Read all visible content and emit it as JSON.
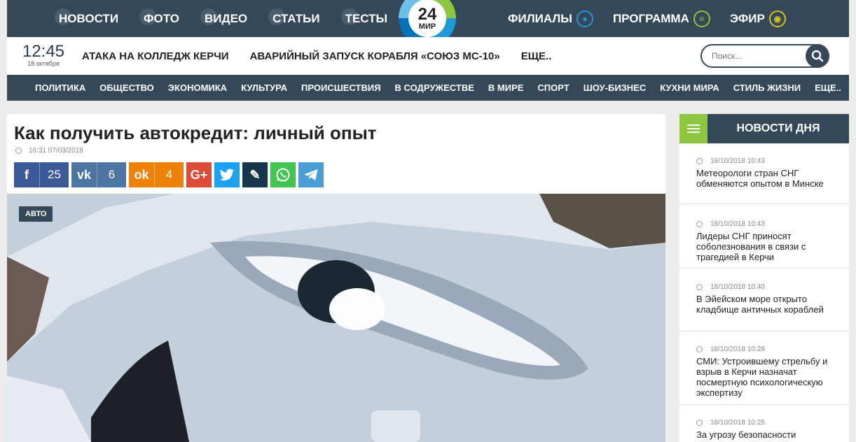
{
  "topnav": {
    "items": [
      "НОВОСТИ",
      "ФОТО",
      "ВИДЕО",
      "СТАТЬИ",
      "ТЕСТЫ"
    ],
    "right": [
      {
        "label": "ФИЛИАЛЫ",
        "icon": "map-pin-icon"
      },
      {
        "label": "ПРОГРАММА",
        "icon": "document-list-icon"
      },
      {
        "label": "ЭФИР",
        "icon": "broadcast-icon"
      }
    ]
  },
  "logo": {
    "number": "24",
    "name": "МИР"
  },
  "clock": {
    "time": "12:45",
    "date": "18 октября"
  },
  "headlines": [
    "АТАКА НА КОЛЛЕДЖ КЕРЧИ",
    "АВАРИЙНЫЙ ЗАПУСК КОРАБЛЯ «СОЮЗ МС-10»",
    "ЕЩЕ.."
  ],
  "search": {
    "placeholder": "Поиск..."
  },
  "categories": [
    "ПОЛИТИКА",
    "ОБЩЕСТВО",
    "ЭКОНОМИКА",
    "КУЛЬТУРА",
    "ПРОИСШЕСТВИЯ",
    "В СОДРУЖЕСТВЕ",
    "В МИРЕ",
    "СПОРТ",
    "ШОУ-БИЗНЕС",
    "КУХНИ МИРА",
    "СТИЛЬ ЖИЗНИ",
    "ЕЩЕ.."
  ],
  "article": {
    "title": "Как получить автокредит: личный опыт",
    "datetime": "16:31 07/03/2018",
    "badge": "АВТО",
    "share": [
      {
        "network": "facebook",
        "glyph": "f",
        "count": "25",
        "color": "#3b5998"
      },
      {
        "network": "vkontakte",
        "glyph": "vk",
        "count": "6",
        "color": "#4c75a3"
      },
      {
        "network": "odnoklassniki",
        "glyph": "ok",
        "count": "4",
        "color": "#ee8208"
      },
      {
        "network": "google-plus",
        "glyph": "G+",
        "count": "",
        "color": "#dd4b39"
      },
      {
        "network": "twitter",
        "glyph": "t",
        "count": "",
        "color": "#1da1f2"
      },
      {
        "network": "livejournal",
        "glyph": "✎",
        "count": "",
        "color": "#15374c"
      },
      {
        "network": "whatsapp",
        "glyph": "w",
        "count": "",
        "color": "#43c553"
      },
      {
        "network": "telegram",
        "glyph": "➤",
        "count": "",
        "color": "#4a9ed6"
      }
    ]
  },
  "sidebar": {
    "title": "НОВОСТИ ДНЯ",
    "news": [
      {
        "time": "18/10/2018 10:43",
        "text": "Метеорологи стран СНГ обменяются опытом в Минске"
      },
      {
        "time": "18/10/2018 10:43",
        "text": "Лидеры СНГ приносят соболезнования в связи с трагедией в Керчи"
      },
      {
        "time": "18/10/2018 10:40",
        "text": "В Эйейском море открыто кладбище античных кораблей"
      },
      {
        "time": "18/10/2018 10:29",
        "text": "СМИ: Устроившему стрельбу и взрыв в Керчи назначат посмертную психологическую экспертизу"
      },
      {
        "time": "18/10/2018 10:25",
        "text": "За угрозу безопасности"
      }
    ]
  }
}
